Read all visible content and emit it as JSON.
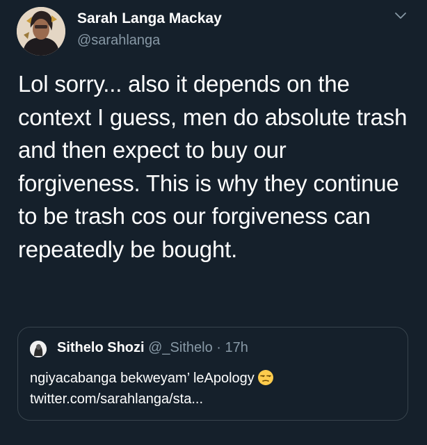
{
  "tweet": {
    "author_name": "Sarah Langa Mackay",
    "author_handle": "@sarahlanga",
    "avatar_icon": "profile-photo",
    "menu_icon": "chevron-down-icon",
    "text": "Lol sorry... also it depends on the context I guess, men do absolute trash and then expect to buy our forgiveness. This is why they continue to be trash cos our forgiveness can repeatedly be bought."
  },
  "quoted_tweet": {
    "author_name": "Sithelo Shozi",
    "author_handle": "@_Sithelo",
    "separator": "·",
    "time": "17h",
    "text": "ngiyacabanga bekweyam’ leApology",
    "emoji_icon": "unamused-face-emoji",
    "link": "twitter.com/sarahlanga/sta..."
  },
  "colors": {
    "background": "#15202b",
    "text_primary": "#ffffff",
    "text_secondary": "#8899a6",
    "border": "#38444d"
  }
}
